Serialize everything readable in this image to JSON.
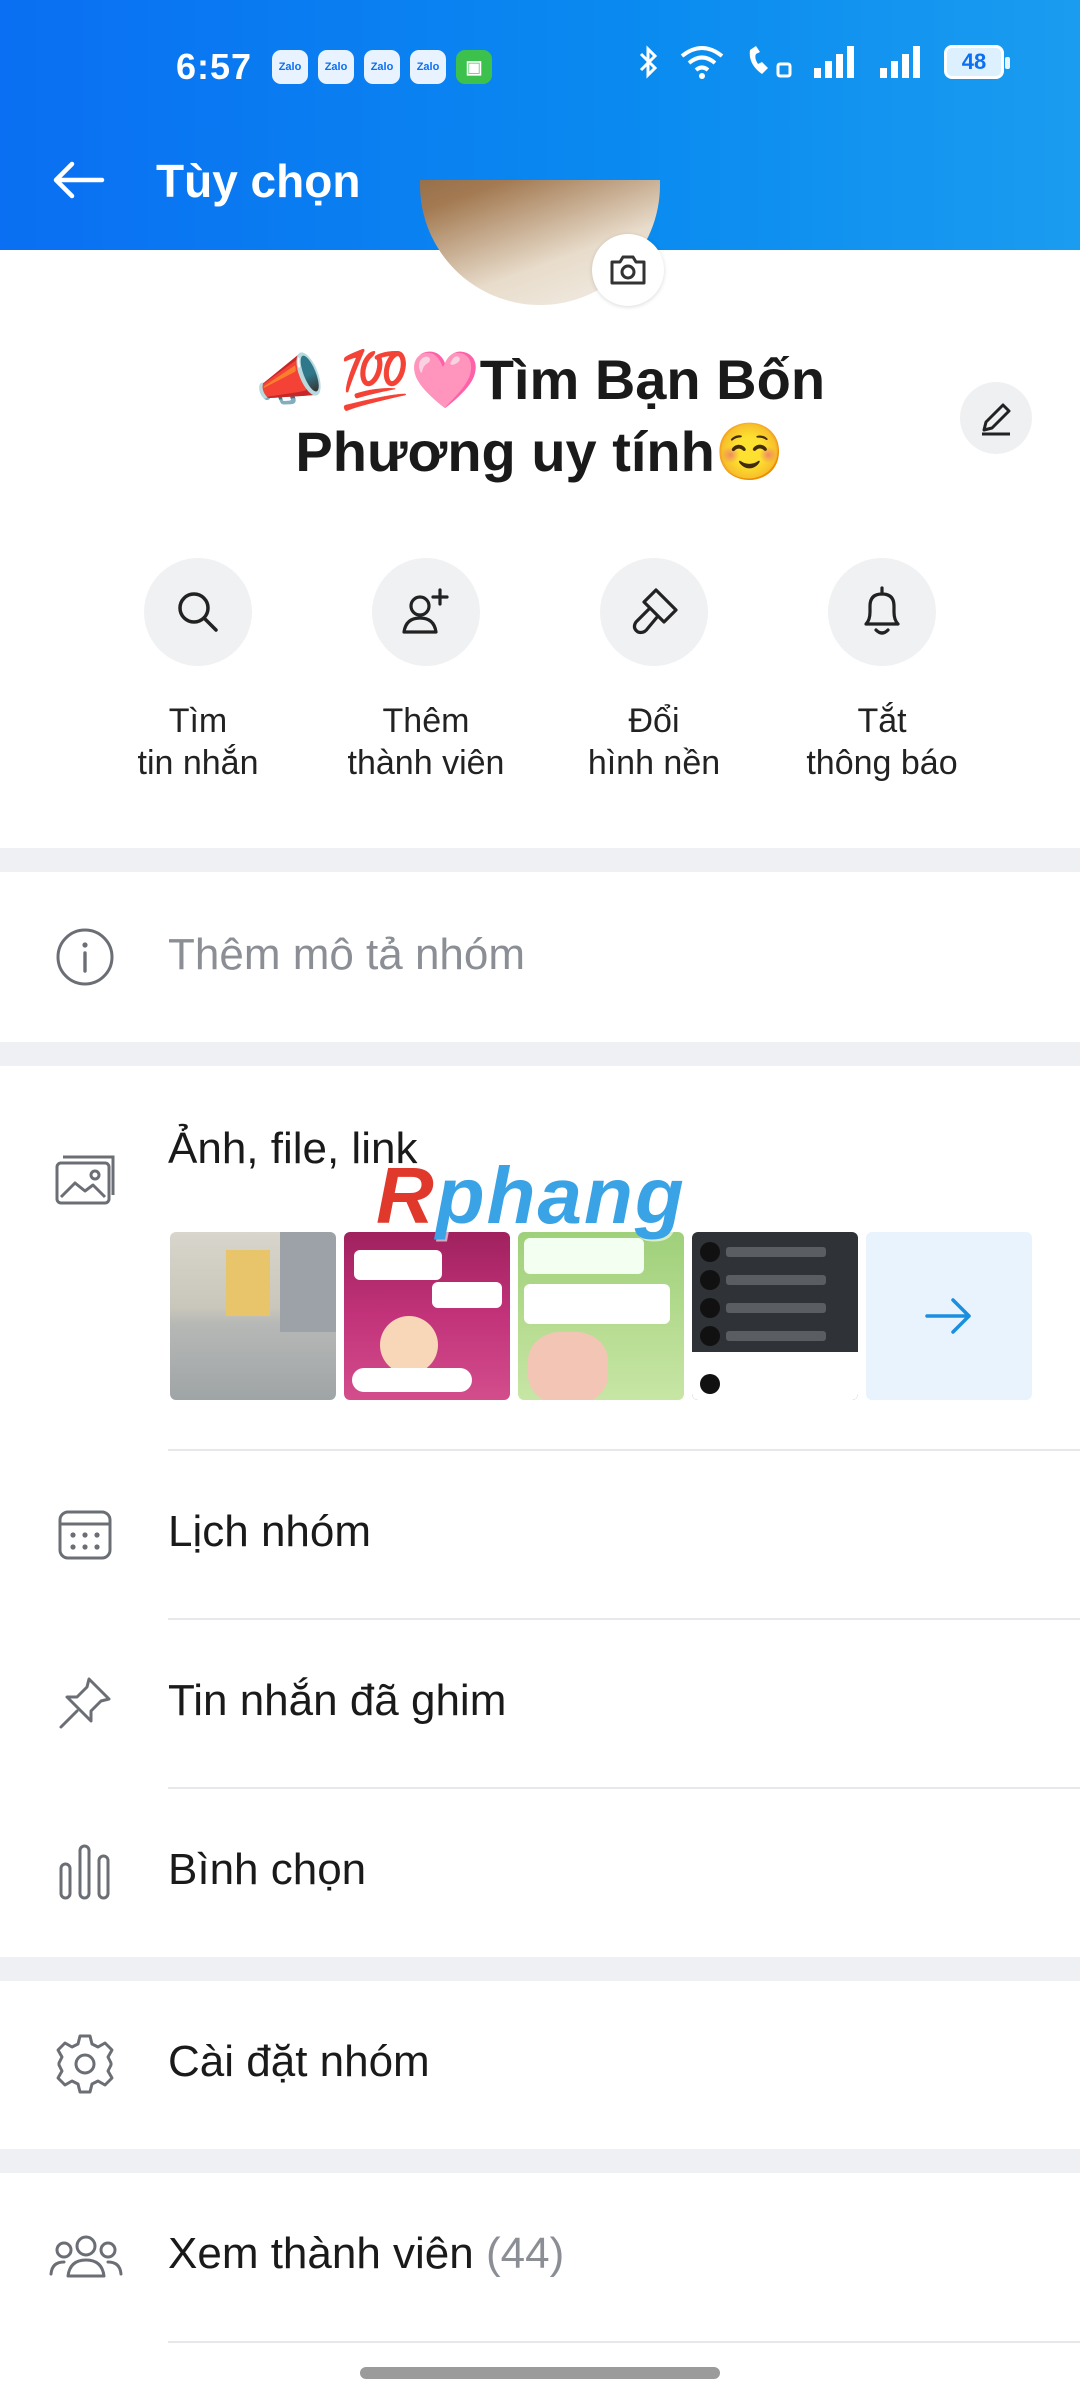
{
  "status_bar": {
    "time": "6:57",
    "notifications": [
      "Zalo",
      "Zalo",
      "Zalo",
      "Zalo"
    ],
    "battery": "48"
  },
  "header": {
    "title": "Tùy chọn",
    "back_icon": "arrow-left-icon"
  },
  "group": {
    "name": "📣 💯🩷Tìm Bạn Bốn Phương uy tính☺️"
  },
  "quick_actions": [
    {
      "label": "Tìm\ntin nhắn",
      "icon": "search-icon"
    },
    {
      "label": "Thêm\nthành viên",
      "icon": "add-member-icon"
    },
    {
      "label": "Đổi\nhình nền",
      "icon": "paint-brush-icon"
    },
    {
      "label": "Tắt\nthông báo",
      "icon": "bell-icon"
    }
  ],
  "description": {
    "placeholder": "Thêm mô tả nhóm"
  },
  "media": {
    "label": "Ảnh, file, link",
    "thumb_count": 4
  },
  "menu": {
    "calendar": "Lịch nhóm",
    "pinned": "Tin nhắn đã ghim",
    "poll": "Bình chọn",
    "settings": "Cài đặt nhóm",
    "members": "Xem thành viên",
    "members_count": "(44)"
  },
  "watermark": {
    "first": "R",
    "rest": "phang"
  },
  "colors": {
    "header": "#0a7ff2",
    "accent": "#1a8fe0",
    "separator": "#eef0f3"
  }
}
